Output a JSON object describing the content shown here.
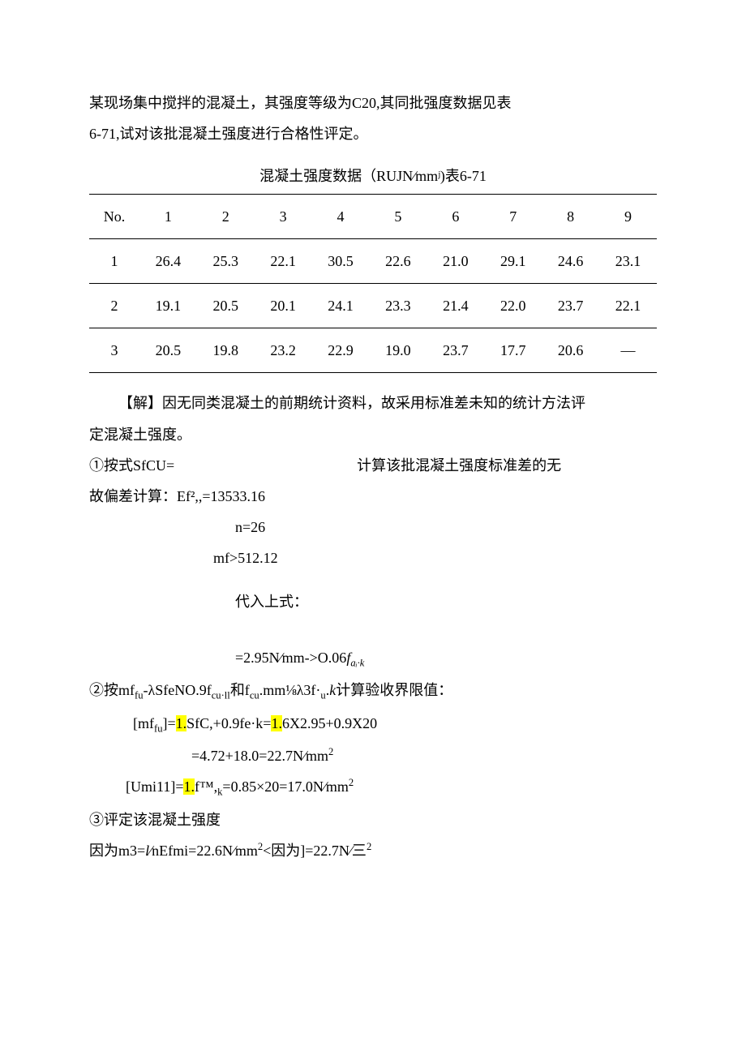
{
  "intro": {
    "line1": "某现场集中搅拌的混凝土，其强度等级为C20,其同批强度数据见表",
    "line2": "6-71,试对该批混凝土强度进行合格性评定。"
  },
  "tableCaption": "混凝土强度数据（RUJN∕mmʲ)表6-71",
  "table": {
    "headers": [
      "No.",
      "1",
      "2",
      "3",
      "4",
      "5",
      "6",
      "7",
      "8",
      "9"
    ],
    "rows": [
      [
        "1",
        "26.4",
        "25.3",
        "22.1",
        "30.5",
        "22.6",
        "21.0",
        "29.1",
        "24.6",
        "23.1"
      ],
      [
        "2",
        "19.1",
        "20.5",
        "20.1",
        "24.1",
        "23.3",
        "21.4",
        "22.0",
        "23.7",
        "22.1"
      ],
      [
        "3",
        "20.5",
        "19.8",
        "23.2",
        "22.9",
        "19.0",
        "23.7",
        "17.7",
        "20.6",
        "—"
      ]
    ]
  },
  "solution": {
    "p1a": "【解】因无同类混凝土的前期统计资料，故采用标准差未知的统计方法评",
    "p1b": "定混凝土强度。",
    "p2_left": "①按式SfCU=",
    "p2_right": "计算该批混凝土强度标准差的无",
    "p3": "故偏差计算：Ef²,,=13533.16",
    "p4": "n=26",
    "p5": "mf>512.12",
    "p6": "代入上式：",
    "p7_pre": "=2.95N∕mm->O.06",
    "p7_var": "f",
    "p7_sub": "aᵢ·k",
    "p8_pre": "②按mf",
    "p8_sub1": "fu",
    "p8_mid1": "-λSfeNO.9f",
    "p8_sub2": "cu·ll",
    "p8_mid2": "和f",
    "p8_sub3": "cu",
    "p8_mid3": ".mm⅛λ3f·",
    "p8_sub4": "u",
    "p8_mid4": ".",
    "p8_var": "k",
    "p8_end": "计算验收界限值：",
    "p9_pre": "[mf",
    "p9_sub": "fu",
    "p9_mid1": "]=",
    "p9_hl1": "1.",
    "p9_mid2": "SfC,+0.9fe·k=",
    "p9_hl2": "1.",
    "p9_end": "6X2.95+0.9X20",
    "p10": "=4.72+18.0=22.7N∕mm",
    "p10_sup": "2",
    "p11_pre": "[Umi11]=",
    "p11_hl": "1.",
    "p11_mid": "f™,",
    "p11_sub": "k",
    "p11_end": "=0.85×20=17.0N∕mm",
    "p11_sup": "2",
    "p12": "③评定该混凝土强度",
    "p13_pre": "因为m3=",
    "p13_var": "l",
    "p13_mid1": "∕nEfmi=22.6N∕mm",
    "p13_sup1": "2",
    "p13_mid2": "<因为]=22.7N∕三",
    "p13_sup2": "2"
  }
}
